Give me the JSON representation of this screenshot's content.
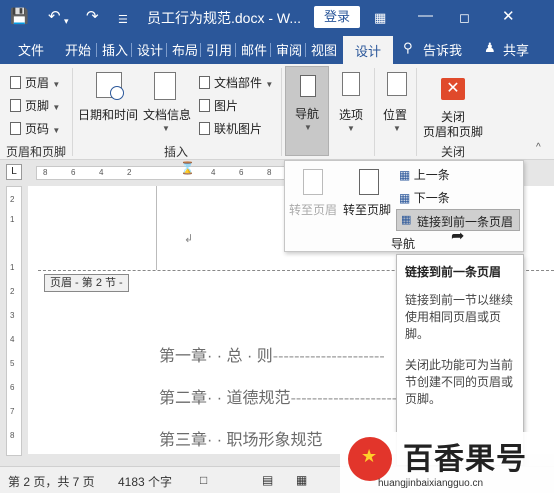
{
  "titlebar": {
    "doc_title": "员工行为规范.docx - W...",
    "login": "登录"
  },
  "tabs": [
    "文件",
    "开始",
    "插入",
    "设计",
    "布局",
    "引用",
    "邮件",
    "审阅",
    "视图"
  ],
  "active_tab": "设计",
  "tell_me": "告诉我",
  "share": "共享",
  "ribbon": {
    "header": "页眉",
    "footer": "页脚",
    "page_number": "页码",
    "group_header_footer": "页眉和页脚",
    "date_time": "日期和时间",
    "doc_info": "文档信息",
    "doc_parts": "文档部件",
    "picture": "图片",
    "online_picture": "联机图片",
    "group_insert": "插入",
    "navigation": "导航",
    "options": "选项",
    "position": "位置",
    "close_line1": "关闭",
    "close_line2": "页眉和页脚",
    "group_close": "关闭"
  },
  "nav_popup": {
    "goto_header": "转至页眉",
    "goto_footer": "转至页脚",
    "previous": "上一条",
    "next": "下一条",
    "link_to_previous": "链接到前一条页眉",
    "group_label": "导航"
  },
  "tooltip": {
    "title": "链接到前一条页眉",
    "body1": "链接到前一节以继续使用相同页眉或页脚。",
    "body2": "关闭此功能可为当前节创建不同的页眉或页脚。"
  },
  "ruler": {
    "ticks": [
      "8",
      "6",
      "4",
      "2",
      "4",
      "6",
      "8"
    ],
    "v_ticks": [
      "2",
      "1",
      "1",
      "2",
      "3",
      "4",
      "5",
      "6",
      "7",
      "8"
    ]
  },
  "document": {
    "header_tag": "页眉 - 第 2 节 -",
    "toc": [
      "第一章· · 总 · 则",
      "第二章· · 道德规范",
      "第三章· · 职场形象规范"
    ]
  },
  "status": {
    "page": "第 2 页，共 7 页",
    "words": "4183 个字"
  },
  "watermark": {
    "brand": "百香果号",
    "url": "huangjinbaixiangguo.cn"
  },
  "colors": {
    "title_blue": "#2b579a",
    "close_red": "#e04a2b",
    "logo_red": "#e2352b"
  }
}
